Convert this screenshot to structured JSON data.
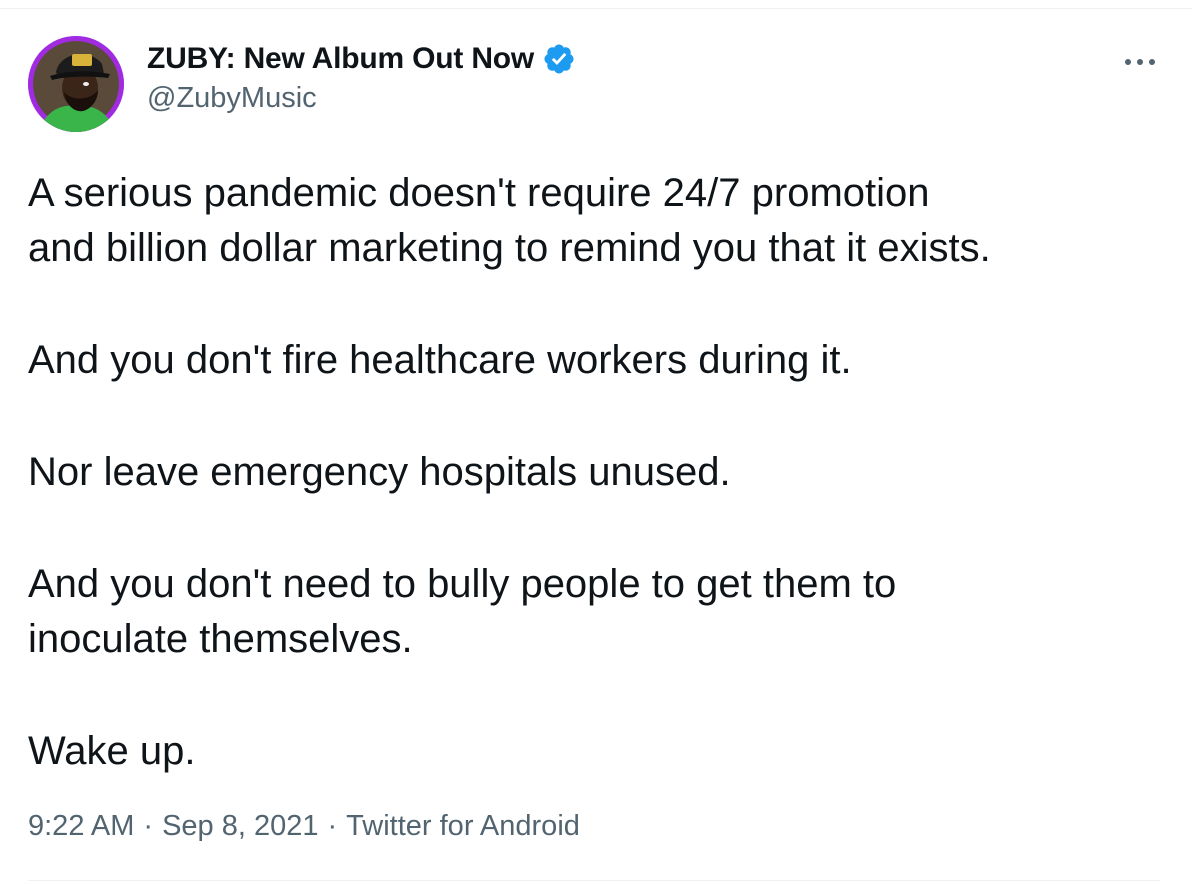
{
  "tweet": {
    "author": {
      "display_name": "ZUBY: New Album Out Now",
      "handle": "@ZubyMusic",
      "verified": true
    },
    "text_paragraphs": [
      [
        "A serious pandemic doesn't require 24/7 promotion",
        "and billion dollar marketing to remind you that it exists."
      ],
      [
        "And you don't fire healthcare workers during it."
      ],
      [
        "Nor leave emergency hospitals unused."
      ],
      [
        "And you don't need to bully people to get them to",
        "inoculate themselves."
      ],
      [
        "Wake up."
      ]
    ],
    "meta": {
      "time": "9:22 AM",
      "separator": "·",
      "date": "Sep 8, 2021",
      "source": "Twitter for Android"
    }
  },
  "icons": {
    "more": "more-horizontal-icon",
    "verified": "verified-badge-icon"
  },
  "colors": {
    "verified_blue": "#1d9bf0",
    "text_primary": "#0f1419",
    "text_secondary": "#536471",
    "avatar_ring": "#a12be0"
  }
}
